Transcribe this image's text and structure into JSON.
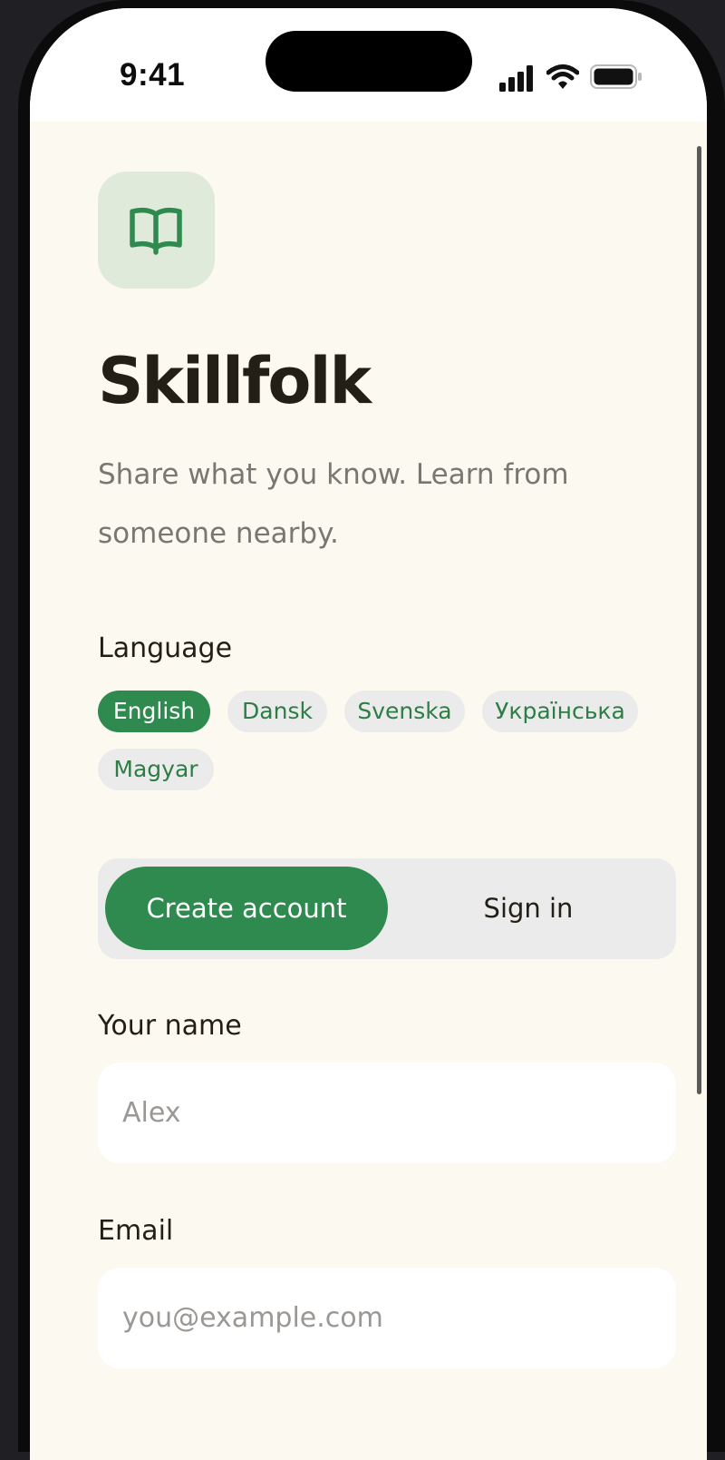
{
  "status_bar": {
    "time": "9:41"
  },
  "app": {
    "name": "Skillfolk",
    "tagline": "Share what you know. Learn from someone nearby.",
    "logo_icon": "open-book-icon",
    "accent_color": "#2e8a4e"
  },
  "language": {
    "label": "Language",
    "selected": "English",
    "options": [
      "English",
      "Dansk",
      "Svenska",
      "Українська",
      "Magyar"
    ]
  },
  "auth_mode": {
    "selected": "Create account",
    "create_account_label": "Create account",
    "sign_in_label": "Sign in"
  },
  "form": {
    "name_label": "Your name",
    "name_placeholder": "Alex",
    "email_label": "Email",
    "email_placeholder": "you@example.com"
  }
}
